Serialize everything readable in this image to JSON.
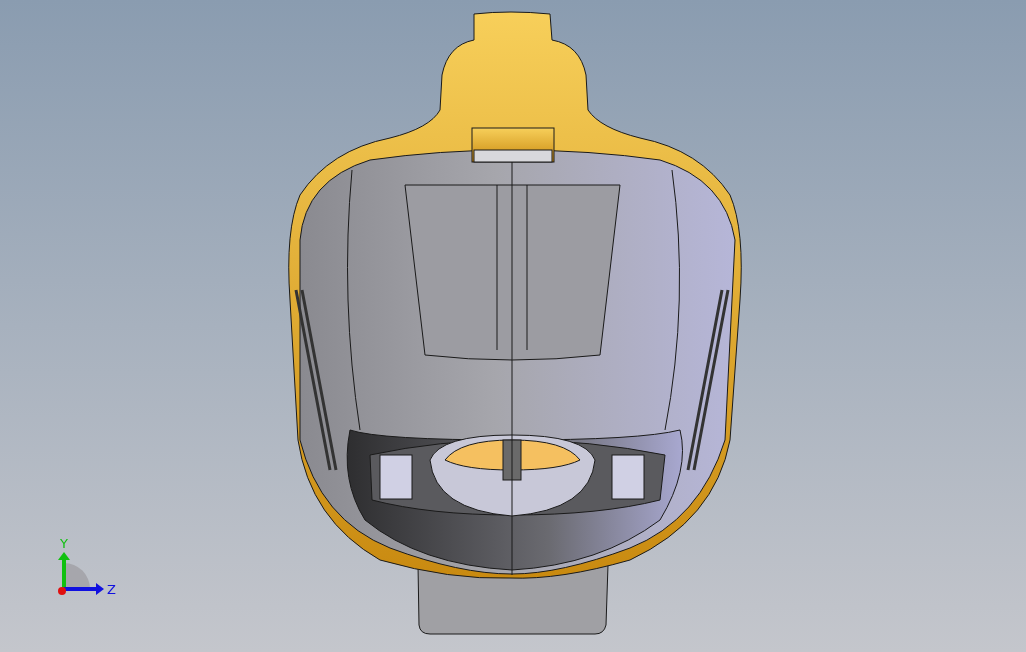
{
  "viewport": {
    "triad": {
      "axes": [
        {
          "label": "Y",
          "kind": "vertical",
          "color": "#10c010"
        },
        {
          "label": "Z",
          "kind": "horizontal",
          "color": "#1010e0"
        }
      ]
    }
  }
}
